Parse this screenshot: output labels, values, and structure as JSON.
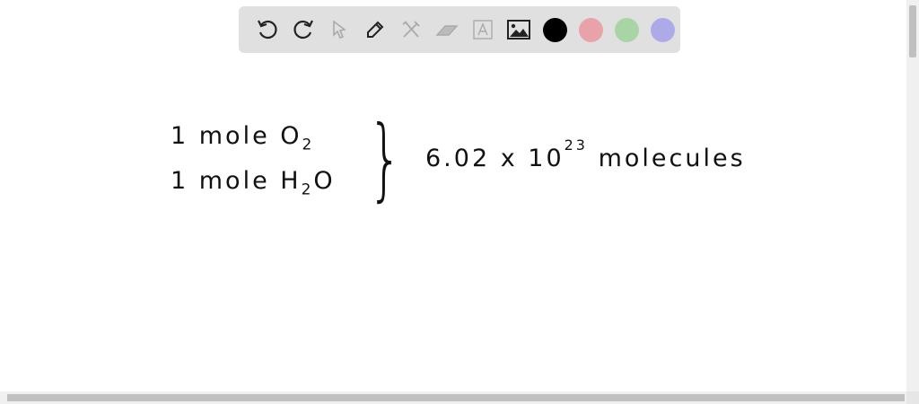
{
  "toolbar": {
    "tools": [
      "undo-icon",
      "redo-icon",
      "pointer-icon",
      "pen-icon",
      "tools-icon",
      "eraser-icon",
      "text-icon",
      "image-icon"
    ],
    "colors": [
      "#000000",
      "#e8a3aa",
      "#a9d4a6",
      "#aeaaea"
    ]
  },
  "canvas": {
    "line1_prefix": "1 mole O",
    "line1_sub": "2",
    "line2_prefix": "1 mole H",
    "line2_sub": "2",
    "line2_suffix": "O",
    "brace": "}",
    "value": "6.02 x 10",
    "exponent": "23",
    "unit": "molecules"
  }
}
